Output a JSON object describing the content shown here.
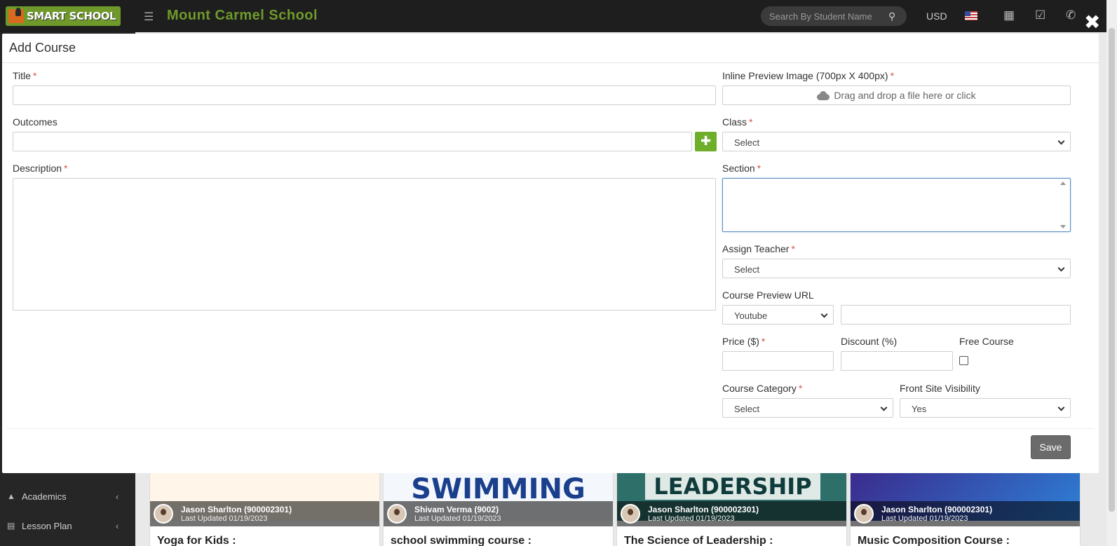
{
  "app": {
    "logo_text": "SMART SCHOOL",
    "school_name": "Mount Carmel School",
    "search_placeholder": "Search By Student Name",
    "currency": "USD"
  },
  "sidebar": {
    "items": [
      {
        "label": "Academics"
      },
      {
        "label": "Lesson Plan"
      }
    ]
  },
  "courses": [
    {
      "thumb_text": "",
      "teacher": "Jason Sharlton (900002301)",
      "updated": "Last Updated 01/19/2023",
      "title": "Yoga for Kids :"
    },
    {
      "thumb_text": "SWIMMING",
      "teacher": "Shivam Verma (9002)",
      "updated": "Last Updated 01/19/2023",
      "title": "school swimming course :"
    },
    {
      "thumb_text": "LEADERSHIP",
      "teacher": "Jason Sharlton (900002301)",
      "updated": "Last Updated 01/19/2023",
      "title": "The Science of Leadership :"
    },
    {
      "thumb_text": "",
      "teacher": "Jason Sharlton (900002301)",
      "updated": "Last Updated 01/19/2023",
      "title": "Music Composition Course :"
    }
  ],
  "modal": {
    "title": "Add Course",
    "required_mark": "*",
    "fields": {
      "title": {
        "label": "Title",
        "value": ""
      },
      "outcomes": {
        "label": "Outcomes",
        "value": ""
      },
      "description": {
        "label": "Description"
      },
      "preview_image": {
        "label": "Inline Preview Image (700px X 400px)",
        "drop_text": "Drag and drop a file here or click"
      },
      "class": {
        "label": "Class",
        "value": "Select"
      },
      "section": {
        "label": "Section"
      },
      "assign_teacher": {
        "label": "Assign Teacher",
        "value": "Select"
      },
      "course_preview_url": {
        "label": "Course Preview URL",
        "provider": "Youtube",
        "url": ""
      },
      "price": {
        "label": "Price ($)",
        "value": ""
      },
      "discount": {
        "label": "Discount (%)",
        "value": ""
      },
      "free_course": {
        "label": "Free Course",
        "checked": false
      },
      "course_category": {
        "label": "Course Category",
        "value": "Select"
      },
      "front_site_visibility": {
        "label": "Front Site Visibility",
        "value": "Yes"
      }
    },
    "save_label": "Save",
    "close_glyph": "✖",
    "plus_glyph": "✚"
  }
}
